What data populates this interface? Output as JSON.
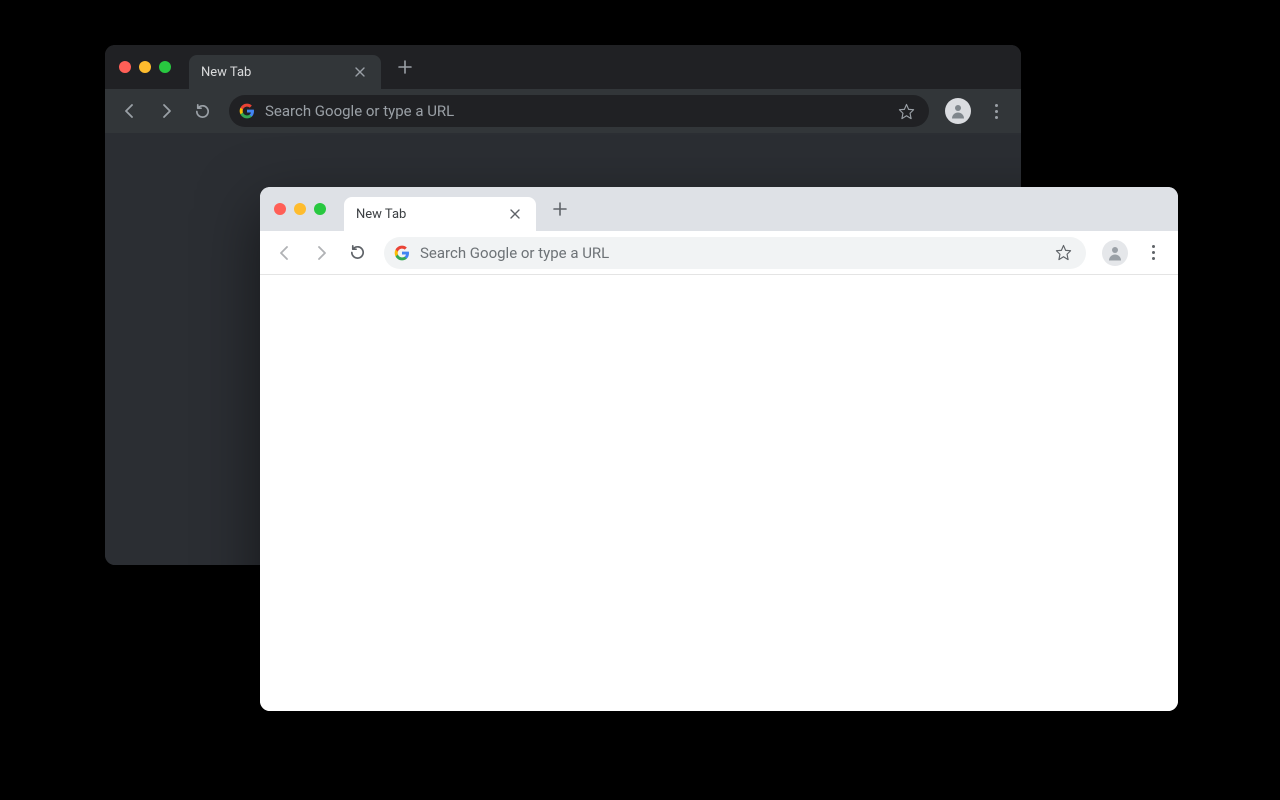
{
  "dark_window": {
    "tab": {
      "title": "New Tab"
    },
    "omnibox": {
      "placeholder": "Search Google or type a URL"
    }
  },
  "light_window": {
    "tab": {
      "title": "New Tab"
    },
    "omnibox": {
      "placeholder": "Search Google or type a URL"
    }
  },
  "colors": {
    "traffic_red": "#ff5f57",
    "traffic_yellow": "#febc2e",
    "traffic_green": "#28c840",
    "dark_bg": "#202124",
    "light_bg": "#ffffff"
  }
}
